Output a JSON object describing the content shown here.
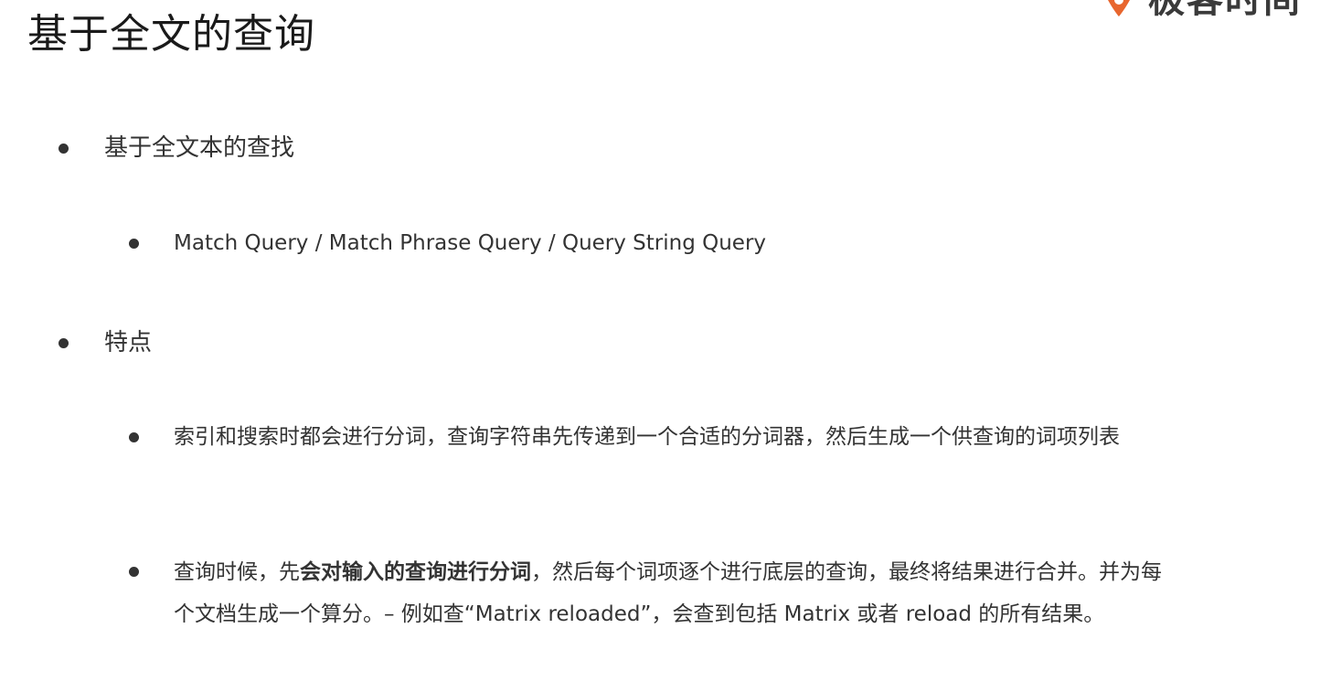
{
  "title": "基于全文的查询",
  "logo": {
    "text": "极客时间",
    "brand_color": "#E8662E"
  },
  "sections": [
    {
      "label": "基于全文本的查找",
      "items": [
        {
          "text": "Match Query / Match Phrase Query / Query String Query"
        }
      ]
    },
    {
      "label": "特点",
      "items": [
        {
          "text": "索引和搜索时都会进行分词，查询字符串先传递到一个合适的分词器，然后生成一个供查询的词项列表"
        },
        {
          "before": "查询时候，先",
          "emphasis": "会对输入的查询进行分词",
          "after": "，然后每个词项逐个进行底层的查询，最终将结果进行合并。并为每个文档生成一个算分。– 例如查“Matrix reloaded”，会查到包括 Matrix 或者 reload 的所有结果。"
        }
      ]
    }
  ]
}
